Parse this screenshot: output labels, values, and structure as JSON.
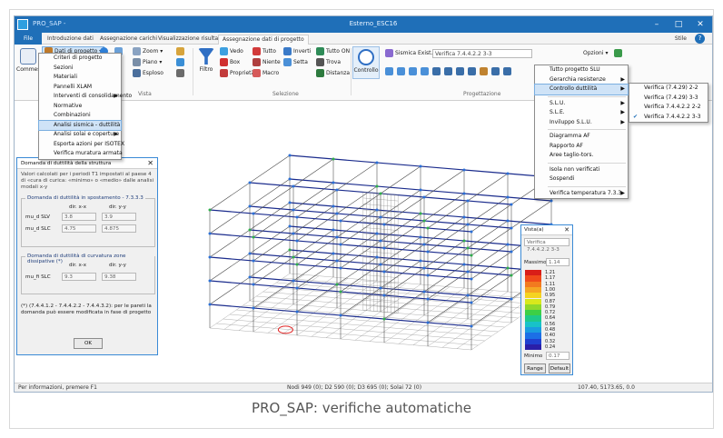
{
  "app": {
    "title": "Esterno_ESC16",
    "quick_access": "PRO_SAP -",
    "style_label": "Stile",
    "tabs": [
      "File",
      "Introduzione dati",
      "Assegnazione carichi",
      "Visualizzazione risultati",
      "Assegnazione dati di progetto"
    ],
    "active_tab": "Assegnazione dati di progetto"
  },
  "ribbon": {
    "commesse_label": "Commesse",
    "dati_progetto_label": "Dati di progetto",
    "zoom_label": "Zoom",
    "piano_label": "Piano",
    "esploso_label": "Esploso",
    "vista_group": "Vista",
    "filtro_label": "Filtro",
    "vedo_label": "Vedo",
    "tutto_label": "Tutto",
    "inverti_label": "Inverti",
    "tutto_on_label": "Tutto ON",
    "box_label": "Box",
    "niente_label": "Niente",
    "setta_label": "Setta",
    "trova_label": "Trova",
    "proprieta_label": "Proprietà",
    "macro_label": "Macro",
    "distanza_label": "Distanza",
    "selezione_group": "Selezione",
    "controllo_label": "Controllo",
    "sismica_label": "Sismica Exist.",
    "verifica_combo": "Verifica 7.4.4.2.2 3-3",
    "opzioni_label": "Opzioni",
    "progettazione_group": "Progettazione"
  },
  "dati_menu": [
    {
      "label": "Criteri di progetto",
      "arrow": false
    },
    {
      "label": "Sezioni",
      "arrow": false
    },
    {
      "label": "Materiali",
      "arrow": false
    },
    {
      "label": "Pannelli XLAM",
      "arrow": false
    },
    {
      "label": "Interventi di consolidamento",
      "arrow": true
    },
    {
      "label": "Normative",
      "arrow": false
    },
    {
      "label": "Combinazioni",
      "arrow": false
    },
    {
      "label": "Analisi sismica - duttilità",
      "arrow": false,
      "highlight": true
    },
    {
      "label": "Analisi solai e coperture",
      "arrow": true
    },
    {
      "label": "Esporta azioni per ISOTEX",
      "arrow": false
    },
    {
      "label": "Verifica muratura armata",
      "arrow": false
    }
  ],
  "progettazione_menu": [
    {
      "label": "Tutto progetto SLU",
      "arrow": false
    },
    {
      "label": "Gerarchia resistenze",
      "arrow": true
    },
    {
      "label": "Controllo duttilità",
      "arrow": true,
      "highlight": true
    },
    {
      "sep": true
    },
    {
      "label": "S.L.U.",
      "arrow": true
    },
    {
      "label": "S.L.E.",
      "arrow": true
    },
    {
      "label": "Inviluppo S.L.U.",
      "arrow": true
    },
    {
      "sep": true
    },
    {
      "label": "Diagramma AF",
      "arrow": false
    },
    {
      "label": "Rapporto AF",
      "arrow": false
    },
    {
      "label": "Aree taglio-tors.",
      "arrow": false
    },
    {
      "sep": true
    },
    {
      "label": "Isola non verificati",
      "arrow": false
    },
    {
      "label": "Sospendi",
      "arrow": false
    },
    {
      "sep": true
    },
    {
      "label": "Verifica temperatura 7.3.3",
      "arrow": true
    }
  ],
  "duttilita_menu": [
    {
      "label": "Verifica (7.4.29) 2-2",
      "checked": false
    },
    {
      "label": "Verifica (7.4.29) 3-3",
      "checked": false
    },
    {
      "label": "Verifica 7.4.4.2.2 2-2",
      "checked": false
    },
    {
      "label": "Verifica 7.4.4.2.2 3-3",
      "checked": true
    }
  ],
  "dialog": {
    "title": "Domanda di duttilità della struttura",
    "note": "Valori calcolati per i periodi T1 impostati al paese 4 di «cura di curica: «minimo» o «medio» dalle analisi modali x-y",
    "section1_title": "Domanda di duttilità in spostamento - 7.3.3.3",
    "col_x": "dir. x-x",
    "col_y": "dir. y-y",
    "row1_label": "mu_d SLV",
    "row1_x": "3.8",
    "row1_y": "3.9",
    "row2_label": "mu_d SLC",
    "row2_x": "4.75",
    "row2_y": "4.875",
    "section2_title": "Domanda di duttilità di curvatura zone dissipative (*)",
    "row3_label": "mu_fi SLC",
    "row3_x": "9.3",
    "row3_y": "9.38",
    "footnote": "(*) (7.4.4.1.2 - 7.4.4.2.2 - 7.4.4.3.2): per le pareti la domanda può essere modificata in fase di progetto",
    "ok": "OK"
  },
  "legend": {
    "title": "Vista(a)",
    "combo": "Verifica 7.4.4.2.2 3-3",
    "max_label": "Massimo",
    "max_value": "1.14",
    "min_label": "Minimo",
    "min_value": "0.17",
    "scale": [
      "1.21",
      "1.17",
      "1.11",
      "1.00",
      "0.95",
      "0.87",
      "0.79",
      "0.72",
      "0.64",
      "0.56",
      "0.48",
      "0.40",
      "0.32",
      "0.24"
    ],
    "colors": [
      "#d91e18",
      "#f04a1a",
      "#f27a1f",
      "#f5a623",
      "#f5d320",
      "#d8e81c",
      "#8fd82b",
      "#3dcf46",
      "#1ec98a",
      "#18c2c8",
      "#1a9ce0",
      "#1c6fe6",
      "#2040d0",
      "#2a1fa8"
    ],
    "btn1": "Range",
    "btn2": "Default"
  },
  "status": {
    "left": "Per informazioni, premere F1",
    "mid": "Nodi 949 (0); D2 590 (0); D3 695 (0); Solai 72 (0)",
    "right": "107.40, 5173.65, 0.0"
  },
  "caption": "PRO_SAP: verifiche automatiche",
  "colors": {
    "accent": "#1f6fb8",
    "frame_line": "#1a2b8c",
    "node": "#2a6fd6"
  }
}
